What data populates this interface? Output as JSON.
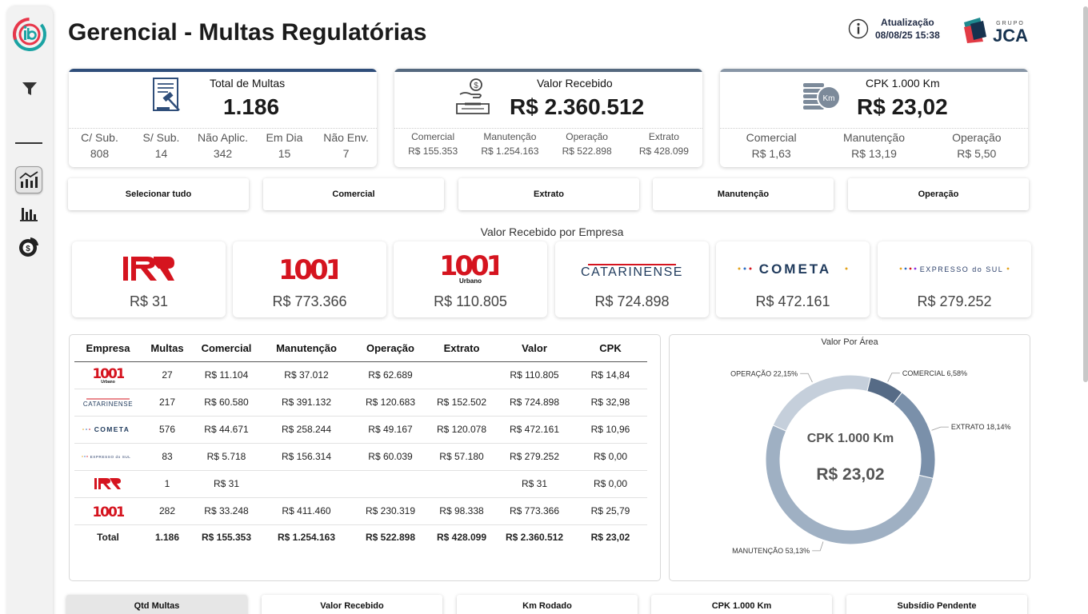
{
  "header": {
    "title": "Gerencial - Multas Regulatórias",
    "update_label": "Atualização",
    "update_value": "08/08/25 15:38",
    "brand_small": "GRUPO",
    "brand_big": "JCA"
  },
  "kpis": {
    "total": {
      "title": "Total de Multas",
      "value": "1.186",
      "icon": "legal-document-icon",
      "cols": [
        {
          "label": "C/ Sub.",
          "value": "808"
        },
        {
          "label": "S/ Sub.",
          "value": "14"
        },
        {
          "label": "Não Aplic.",
          "value": "342"
        },
        {
          "label": "Em Dia",
          "value": "15"
        },
        {
          "label": "Não Env.",
          "value": "7"
        }
      ]
    },
    "valor": {
      "title": "Valor Recebido",
      "value": "R$ 2.360.512",
      "icon": "money-hand-icon",
      "cols": [
        {
          "label": "Comercial",
          "value": "R$ 155.353"
        },
        {
          "label": "Manutenção",
          "value": "R$ 1.254.163"
        },
        {
          "label": "Operação",
          "value": "R$ 522.898"
        },
        {
          "label": "Extrato",
          "value": "R$ 428.099"
        }
      ]
    },
    "cpk": {
      "title": "CPK 1.000 Km",
      "value": "R$ 23,02",
      "icon": "coins-km-icon",
      "cols": [
        {
          "label": "Comercial",
          "value": "R$ 1,63"
        },
        {
          "label": "Manutenção",
          "value": "R$ 13,19"
        },
        {
          "label": "Operação",
          "value": "R$ 5,50"
        }
      ]
    }
  },
  "filters": [
    "Selecionar tudo",
    "Comercial",
    "Extrato",
    "Manutenção",
    "Operação"
  ],
  "companies_title": "Valor Recebido por Empresa",
  "companies": [
    {
      "logo": "RR",
      "value": "R$ 31"
    },
    {
      "logo": "1001",
      "value": "R$ 773.366"
    },
    {
      "logo": "1001",
      "sub": "Urbano",
      "value": "R$ 110.805"
    },
    {
      "logo": "CATARINENSE",
      "value": "R$ 724.898"
    },
    {
      "logo": "COMETA",
      "value": "R$ 472.161"
    },
    {
      "logo": "EXPRESSO do SUL",
      "value": "R$ 279.252"
    }
  ],
  "table": {
    "headers": [
      "Empresa",
      "Multas",
      "Comercial",
      "Manutenção",
      "Operação",
      "Extrato",
      "Valor",
      "CPK"
    ],
    "rows": [
      {
        "logo": "1001 Urbano",
        "cells": [
          "27",
          "R$ 11.104",
          "R$ 37.012",
          "R$ 62.689",
          "",
          "R$ 110.805",
          "R$ 14,84"
        ]
      },
      {
        "logo": "CATARINENSE",
        "cells": [
          "217",
          "R$ 60.580",
          "R$ 391.132",
          "R$ 120.683",
          "R$ 152.502",
          "R$ 724.898",
          "R$ 32,98"
        ]
      },
      {
        "logo": "COMETA",
        "cells": [
          "576",
          "R$ 44.671",
          "R$ 258.244",
          "R$ 49.167",
          "R$ 120.078",
          "R$ 472.161",
          "R$ 10,96"
        ]
      },
      {
        "logo": "EXPRESSO do SUL",
        "cells": [
          "83",
          "R$ 5.718",
          "R$ 156.314",
          "R$ 60.039",
          "R$ 57.180",
          "R$ 279.252",
          "R$ 0,00"
        ]
      },
      {
        "logo": "RR",
        "cells": [
          "1",
          "R$ 31",
          "",
          "",
          "",
          "R$ 31",
          "R$ 0,00"
        ]
      },
      {
        "logo": "1001",
        "cells": [
          "282",
          "R$ 33.248",
          "R$ 411.460",
          "R$ 230.319",
          "R$ 98.338",
          "R$ 773.366",
          "R$ 25,79"
        ]
      }
    ],
    "total": [
      "Total",
      "1.186",
      "R$ 155.353",
      "R$ 1.254.163",
      "R$ 522.898",
      "R$ 428.099",
      "R$ 2.360.512",
      "R$ 23,02"
    ]
  },
  "chart_data": {
    "type": "pie",
    "title": "Valor Por Área",
    "center_label": "CPK 1.000 Km",
    "center_value": "R$ 23,02",
    "categories": [
      "COMERCIAL",
      "EXTRATO",
      "MANUTENÇÃO",
      "OPERAÇÃO"
    ],
    "values": [
      6.58,
      18.14,
      53.13,
      22.15
    ],
    "labels": [
      "COMERCIAL 6,58%",
      "EXTRATO 18,14%",
      "MANUTENÇÃO 53,13%",
      "OPERAÇÃO 22,15%"
    ],
    "colors": [
      "#566b86",
      "#7a90aa",
      "#9fb0c3",
      "#c5cfdb"
    ]
  },
  "bottom_tabs": [
    "Qtd Multas",
    "Valor Recebido",
    "Km Rodado",
    "CPK 1.000 Km",
    "Subsídio Pendente"
  ],
  "colors": {
    "bar_total": "#2f4e7a",
    "bar_valor": "#55697f",
    "bar_cpk": "#8896a6",
    "red_brand": "#d5141f",
    "catarinense": "#1f3a5c"
  }
}
